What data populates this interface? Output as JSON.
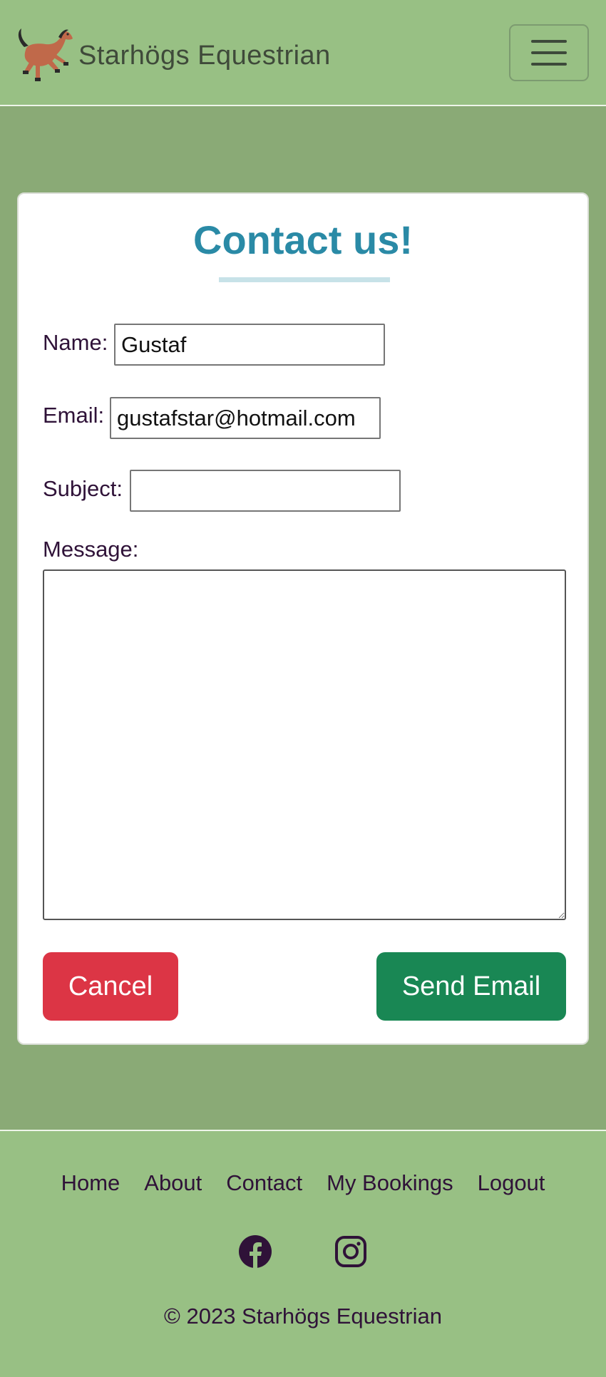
{
  "header": {
    "brand_name": "Starhögs Equestrian",
    "logo_icon": "horse-icon",
    "menu_icon": "hamburger-menu-icon"
  },
  "form": {
    "title": "Contact us!",
    "name_label": "Name:",
    "name_value": "Gustaf",
    "email_label": "Email:",
    "email_value": "gustafstar@hotmail.com",
    "subject_label": "Subject:",
    "subject_value": "",
    "message_label": "Message:",
    "message_value": "",
    "cancel_label": "Cancel",
    "send_label": "Send Email"
  },
  "footer": {
    "nav": [
      "Home",
      "About",
      "Contact",
      "My Bookings",
      "Logout"
    ],
    "social_icons": [
      "facebook-icon",
      "instagram-icon"
    ],
    "copyright": "© 2023 Starhögs Equestrian"
  },
  "colors": {
    "header_bg": "#98c084",
    "page_bg": "#8aaa76",
    "title": "#2a8aa6",
    "text": "#2f1238",
    "cancel": "#dc3545",
    "send": "#198754"
  }
}
